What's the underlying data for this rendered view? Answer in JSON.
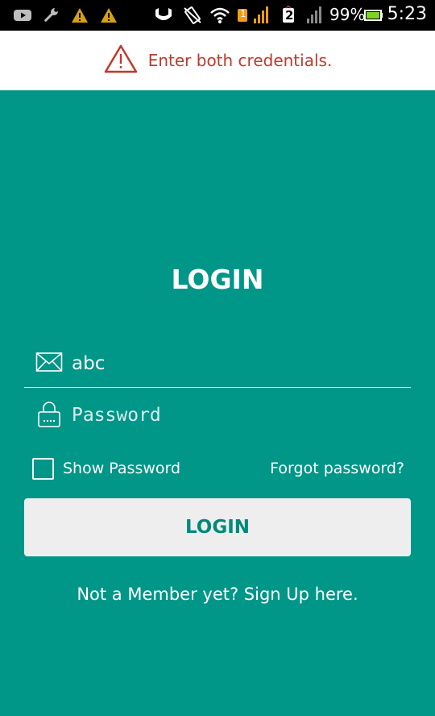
{
  "status_bar": {
    "battery_percent": "99%",
    "time": "5:23",
    "sim1_badge": "1",
    "sim2_badge": "2",
    "icons": [
      "youtube-icon",
      "wrench-icon",
      "warning-icon",
      "warning-icon",
      "vibrate-icon",
      "ringer-icon",
      "wifi-icon",
      "sim1-signal-icon",
      "sim2-signal-icon",
      "battery-icon"
    ]
  },
  "banner": {
    "message": "Enter both credentials.",
    "icon": "warning-triangle-icon",
    "color": "#c0392b"
  },
  "login": {
    "title": "LOGIN",
    "email_value": "abc",
    "email_icon": "envelope-icon",
    "password_placeholder": "Password",
    "password_icon": "lock-icon",
    "show_password_label": "Show Password",
    "show_password_checked": false,
    "forgot_password_label": "Forgot password?",
    "login_button_label": "LOGIN",
    "signup_text": "Not a Member yet? Sign Up here."
  },
  "theme": {
    "primary": "#009688",
    "button_bg": "#eeeeee",
    "button_text": "#00897b"
  }
}
